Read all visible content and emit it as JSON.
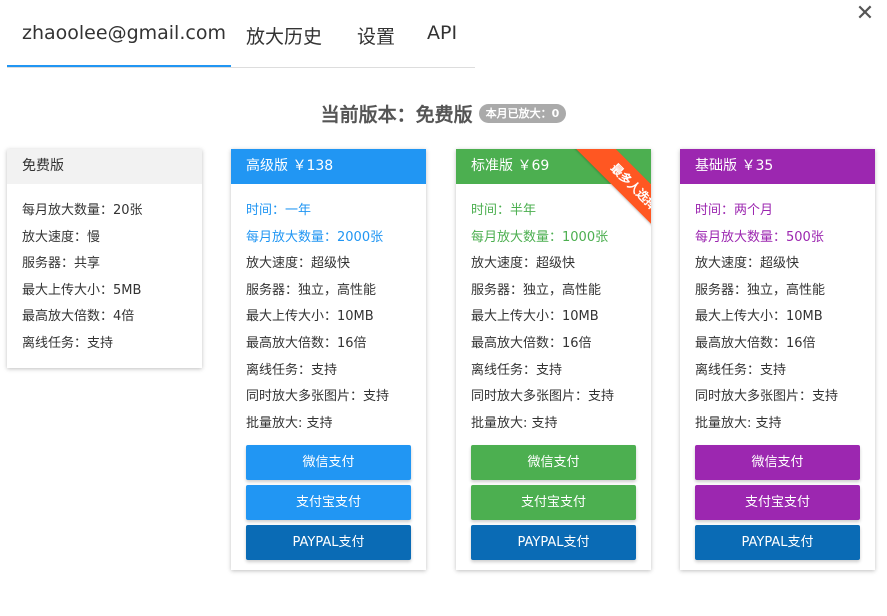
{
  "close_icon": "close-icon",
  "tabs": [
    {
      "label": "zhaoolee@gmail.com",
      "active": true
    },
    {
      "label": "放大历史"
    },
    {
      "label": "设置"
    },
    {
      "label": "API"
    }
  ],
  "heading": {
    "title": "当前版本：免费版",
    "badge": "本月已放大：0"
  },
  "colors": {
    "accent": "#2196f3",
    "premium": "#2196f3",
    "standard": "#4caf50",
    "basic": "#9c27b0",
    "paypal": "#0a6bb5",
    "ribbon": "#ff5722"
  },
  "plans": [
    {
      "header": "免费版",
      "features": [
        "每月放大数量：20张",
        "放大速度：慢",
        "服务器：共享",
        "最大上传大小：5MB",
        "最高放大倍数：4倍",
        "离线任务：支持"
      ]
    },
    {
      "header": "高级版 ￥138",
      "features": [
        "时间：一年",
        "每月放大数量：2000张",
        "放大速度：超级快",
        "服务器：独立，高性能",
        "最大上传大小：10MB",
        "最高放大倍数：16倍",
        "离线任务：支持",
        "同时放大多张图片：支持",
        "批量放大: 支持"
      ],
      "buttons": [
        "微信支付",
        "支付宝支付",
        "PAYPAL支付"
      ]
    },
    {
      "header": "标准版 ￥69",
      "ribbon": "最多人选择",
      "features": [
        "时间：半年",
        "每月放大数量：1000张",
        "放大速度：超级快",
        "服务器：独立，高性能",
        "最大上传大小：10MB",
        "最高放大倍数：16倍",
        "离线任务：支持",
        "同时放大多张图片：支持",
        "批量放大: 支持"
      ],
      "buttons": [
        "微信支付",
        "支付宝支付",
        "PAYPAL支付"
      ]
    },
    {
      "header": "基础版 ￥35",
      "features": [
        "时间：两个月",
        "每月放大数量：500张",
        "放大速度：超级快",
        "服务器：独立，高性能",
        "最大上传大小：10MB",
        "最高放大倍数：16倍",
        "离线任务：支持",
        "同时放大多张图片：支持",
        "批量放大: 支持"
      ],
      "buttons": [
        "微信支付",
        "支付宝支付",
        "PAYPAL支付"
      ]
    }
  ]
}
